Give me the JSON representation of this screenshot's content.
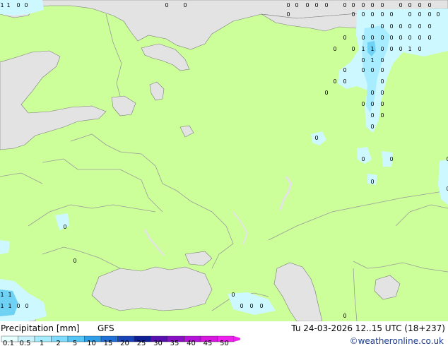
{
  "legend": {
    "title": "Precipitation [mm]",
    "model": "GFS",
    "datetime": "Tu 24-03-2026 12..15 UTC (18+237)",
    "credit": "©weatheronline.co.uk",
    "ticks": [
      "0.1",
      "0.5",
      "1",
      "2",
      "5",
      "10",
      "15",
      "20",
      "25",
      "30",
      "35",
      "40",
      "45",
      "50"
    ],
    "colors": [
      "#e6ffff",
      "#c9f4ff",
      "#a6ecff",
      "#7fdcff",
      "#55c6f5",
      "#2f9fe8",
      "#1f6fd6",
      "#1a45b8",
      "#0f1f96",
      "#5a10b0",
      "#8a10c8",
      "#b412d8",
      "#d818e0",
      "#f020f0"
    ]
  },
  "map": {
    "colors": {
      "land": "#ccff99",
      "sea": "#e3e3e3",
      "precip_light": "#cef8ff",
      "precip_mid": "#a8ecff",
      "precip_heavy": "#6fd2f5",
      "border": "#9a9a9a",
      "coast": "#7a7a7a"
    },
    "cell_labels": [
      "0",
      "1"
    ]
  }
}
